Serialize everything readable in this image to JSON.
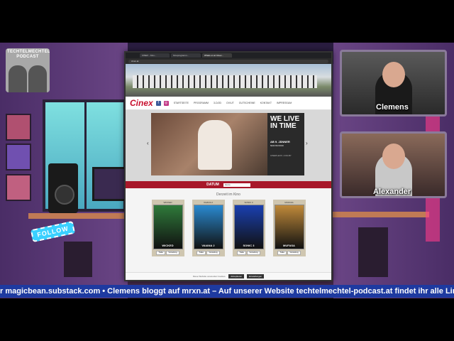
{
  "podcast_logo": {
    "title": "TECHTELMECHTEL PODCAST"
  },
  "follow_label": "FOLLOW",
  "cams": [
    {
      "name": "Clemens"
    },
    {
      "name": "Alexander"
    }
  ],
  "browser": {
    "tabs": [
      "CINEX - Kino...",
      "Kinoprogramm...",
      "Whats on at Cinex..."
    ],
    "url": "cinex.at",
    "site": {
      "logo": "Cinex",
      "facebook_glyph": "f",
      "instagram_glyph": "◎",
      "nav": [
        "STARTSEITE",
        "PROGRAMM",
        "3-D/2D",
        "OV/UT",
        "GUTSCHEINE",
        "KONTAKT",
        "IMPRESSUM"
      ],
      "banner": {
        "headline": "WE LIVE IN TIME",
        "date": "AB 9. JÄNNER",
        "sub": "NUR IM KINO",
        "foot": "CINEPLEXX • DOLBY"
      },
      "datum_label": "DATUM",
      "date_value": "Heute",
      "section_title": "Derzeit im Kino",
      "posters": [
        {
          "top": "WICKED",
          "name": "WICKED",
          "color": "#2f7a3a",
          "btns": [
            "Trailer",
            "Vorstellung"
          ]
        },
        {
          "top": "VAIANA 2",
          "name": "VAIANA 2",
          "color": "#2a8ad0",
          "btns": [
            "Trailer",
            "Vorstellung"
          ]
        },
        {
          "top": "SONIC 3",
          "name": "SONIC 3",
          "color": "#1a40b0",
          "btns": [
            "Trailer",
            "Vorstellung"
          ]
        },
        {
          "top": "MUFASA",
          "name": "MUFASA",
          "color": "#c08a3a",
          "btns": [
            "Trailer",
            "Vorstellung"
          ]
        }
      ],
      "cookie_text": "Diese Website verwendet Cookies.",
      "cookie_accept": "Akzeptieren",
      "cookie_settings": "Einstellungen"
    }
  },
  "ticker_text": "r magicbean.substack.com • Clemens bloggt auf mrxn.at – Auf unserer Website techtelmechtel-podcast.at findet ihr alle Links zu der"
}
